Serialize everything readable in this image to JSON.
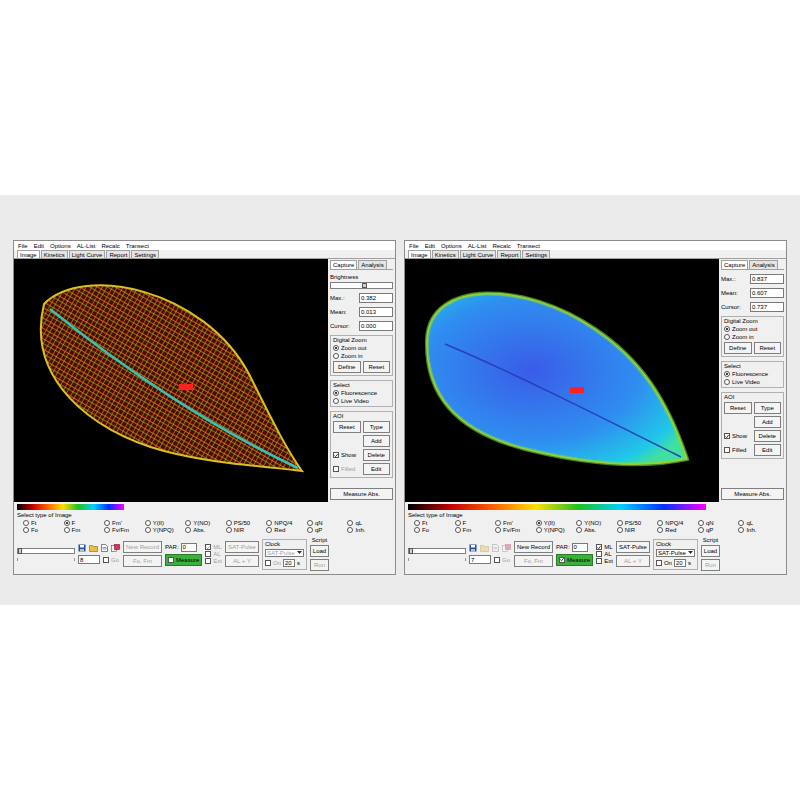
{
  "windows": [
    {
      "menu": [
        "File",
        "Edit",
        "Options",
        "AL-List",
        "Recalc",
        "Transect"
      ],
      "tabs": [
        {
          "label": "Image",
          "selected": true
        },
        {
          "label": "Kinetics",
          "selected": false
        },
        {
          "label": "Light Curve",
          "selected": false
        },
        {
          "label": "Report",
          "selected": false
        },
        {
          "label": "Settings",
          "selected": false
        }
      ],
      "image": {
        "kind": "veins"
      },
      "side_tabs": [
        {
          "label": "Capture",
          "selected": true
        },
        {
          "label": "Analysis",
          "selected": false
        }
      ],
      "brightness": {
        "label": "Brightness",
        "level": 0.55
      },
      "readings": [
        {
          "label": "Max.:",
          "value": "0.382"
        },
        {
          "label": "Mean:",
          "value": "0.013"
        },
        {
          "label": "Cursor:",
          "value": "0.000"
        }
      ],
      "digital_zoom": {
        "title": "Digital Zoom",
        "options": [
          {
            "label": "Zoom out",
            "selected": true
          },
          {
            "label": "Zoom in",
            "selected": false
          }
        ],
        "buttons": [
          {
            "label": "Define",
            "disabled": false
          },
          {
            "label": "Reset",
            "disabled": false
          }
        ]
      },
      "select": {
        "title": "Select",
        "options": [
          {
            "label": "Fluorescence",
            "selected": true
          },
          {
            "label": "Live Video",
            "selected": false
          }
        ]
      },
      "aoi": {
        "title": "AOI",
        "items": [
          {
            "kind": "button",
            "label": "Reset",
            "disabled": false
          },
          {
            "kind": "button",
            "label": "Type",
            "disabled": false
          },
          {
            "kind": "button",
            "label": "Add",
            "disabled": false
          },
          {
            "kind": "check",
            "label": "Show",
            "checked": true,
            "disabled": false
          },
          {
            "kind": "button",
            "label": "Delete",
            "disabled": false
          },
          {
            "kind": "check",
            "label": "Filled",
            "checked": false,
            "disabled": true
          },
          {
            "kind": "button",
            "label": "Edit",
            "disabled": false
          }
        ]
      },
      "measure_abs": {
        "label": "Measure Abs.",
        "disabled": false
      },
      "colorbar": {
        "level": 0.34
      },
      "image_types": {
        "title": "Select type of Image",
        "options": [
          {
            "label": "Ft",
            "selected": false
          },
          {
            "label": "F",
            "selected": true
          },
          {
            "label": "Fm'",
            "selected": false
          },
          {
            "label": "Y(II)",
            "selected": false
          },
          {
            "label": "Y(NO)",
            "selected": false
          },
          {
            "label": "PS/50",
            "selected": false
          },
          {
            "label": "NPQ/4",
            "selected": false
          },
          {
            "label": "qN",
            "selected": false
          },
          {
            "label": "qL",
            "selected": false
          },
          {
            "label": "Fo",
            "selected": false
          },
          {
            "label": "Fm",
            "selected": false
          },
          {
            "label": "Fv/Fm",
            "selected": false
          },
          {
            "label": "Y(NPQ)",
            "selected": false
          },
          {
            "label": "Abs.",
            "selected": false
          },
          {
            "label": "NIR",
            "selected": false
          },
          {
            "label": "Red",
            "selected": false
          },
          {
            "label": "qP",
            "selected": false
          },
          {
            "label": "Inh.",
            "selected": false
          }
        ]
      },
      "controls": {
        "slider": {
          "level": 0
        },
        "icons": [
          {
            "disabled": false
          },
          {
            "disabled": false
          },
          {
            "disabled": false
          },
          {
            "disabled": false
          }
        ],
        "record": "8",
        "go": {
          "label": "Go",
          "checked": false,
          "disabled": true
        },
        "new_record": {
          "label": "New Record",
          "disabled": true
        },
        "fo_fm": {
          "label": "Fo, Fm",
          "disabled": true
        },
        "par": {
          "label": "PAR:",
          "value": "0"
        },
        "measure": {
          "label": "Measure",
          "checked": false,
          "disabled": true
        },
        "lights": [
          {
            "label": "ML",
            "checked": true,
            "disabled": true
          },
          {
            "label": "AL",
            "checked": false,
            "disabled": true
          },
          {
            "label": "Ext",
            "checked": false,
            "disabled": true
          }
        ],
        "sat_pulse": {
          "label": "SAT-Pulse",
          "disabled": true
        },
        "al_y": {
          "label": "AL + Y",
          "disabled": true
        },
        "clock": {
          "title": "Clock",
          "mode": "SAT-Pulse",
          "disabled": true,
          "on": {
            "label": "On",
            "checked": false
          },
          "interval": "20",
          "unit": "s"
        },
        "script": {
          "title": "Script",
          "buttons": [
            {
              "label": "Load",
              "disabled": false
            },
            {
              "label": "Run",
              "disabled": true
            }
          ]
        }
      }
    },
    {
      "menu": [
        "File",
        "Edit",
        "Options",
        "AL-List",
        "Recalc",
        "Transect"
      ],
      "tabs": [
        {
          "label": "Image",
          "selected": true
        },
        {
          "label": "Kinetics",
          "selected": false
        },
        {
          "label": "Light Curve",
          "selected": false
        },
        {
          "label": "Report",
          "selected": false
        },
        {
          "label": "Settings",
          "selected": false
        }
      ],
      "image": {
        "kind": "yield"
      },
      "side_tabs": [
        {
          "label": "Capture",
          "selected": true
        },
        {
          "label": "Analysis",
          "selected": false
        }
      ],
      "readings": [
        {
          "label": "Max.:",
          "value": "0.837"
        },
        {
          "label": "Mean:",
          "value": "0.607"
        },
        {
          "label": "Cursor:",
          "value": "0.737"
        }
      ],
      "digital_zoom": {
        "title": "Digital Zoom",
        "options": [
          {
            "label": "Zoom out",
            "selected": true
          },
          {
            "label": "Zoom in",
            "selected": false
          }
        ],
        "buttons": [
          {
            "label": "Define",
            "disabled": false
          },
          {
            "label": "Reset",
            "disabled": false
          }
        ]
      },
      "select": {
        "title": "Select",
        "options": [
          {
            "label": "Fluorescence",
            "selected": true
          },
          {
            "label": "Live Video",
            "selected": false
          }
        ]
      },
      "aoi": {
        "title": "AOI",
        "items": [
          {
            "kind": "button",
            "label": "Reset",
            "disabled": false
          },
          {
            "kind": "button",
            "label": "Type",
            "disabled": false
          },
          {
            "kind": "button",
            "label": "Add",
            "disabled": false
          },
          {
            "kind": "check",
            "label": "Show",
            "checked": true,
            "disabled": false
          },
          {
            "kind": "button",
            "label": "Delete",
            "disabled": false
          },
          {
            "kind": "check",
            "label": "Filled",
            "checked": false,
            "disabled": false
          },
          {
            "kind": "button",
            "label": "Edit",
            "disabled": false
          }
        ]
      },
      "measure_abs": {
        "label": "Measure Abs.",
        "disabled": false
      },
      "colorbar": {
        "level": 0.95
      },
      "image_types": {
        "title": "Select type of Image",
        "options": [
          {
            "label": "Ft",
            "selected": false
          },
          {
            "label": "F",
            "selected": false
          },
          {
            "label": "Fm'",
            "selected": false
          },
          {
            "label": "Y(II)",
            "selected": true
          },
          {
            "label": "Y(NO)",
            "selected": false
          },
          {
            "label": "PS/50",
            "selected": false
          },
          {
            "label": "NPQ/4",
            "selected": false
          },
          {
            "label": "qN",
            "selected": false
          },
          {
            "label": "qL",
            "selected": false
          },
          {
            "label": "Fo",
            "selected": false
          },
          {
            "label": "Fm",
            "selected": false
          },
          {
            "label": "Fv/Fm",
            "selected": false
          },
          {
            "label": "Y(NPQ)",
            "selected": false
          },
          {
            "label": "Abs.",
            "selected": false
          },
          {
            "label": "NIR",
            "selected": false
          },
          {
            "label": "Red",
            "selected": false
          },
          {
            "label": "qP",
            "selected": false
          },
          {
            "label": "Inh.",
            "selected": false
          }
        ]
      },
      "controls": {
        "slider": {
          "level": 0
        },
        "icons": [
          {
            "disabled": false
          },
          {
            "disabled": true
          },
          {
            "disabled": true
          },
          {
            "disabled": true
          }
        ],
        "record": "7",
        "go": {
          "label": "Go",
          "checked": false,
          "disabled": true
        },
        "new_record": {
          "label": "New Record",
          "disabled": false
        },
        "fo_fm": {
          "label": "Fo, Fm",
          "disabled": true
        },
        "par": {
          "label": "PAR:",
          "value": "0"
        },
        "measure": {
          "label": "Measure",
          "checked": true,
          "disabled": false
        },
        "lights": [
          {
            "label": "ML",
            "checked": true,
            "disabled": false
          },
          {
            "label": "AL",
            "checked": false,
            "disabled": false
          },
          {
            "label": "Ext",
            "checked": false,
            "disabled": false
          }
        ],
        "sat_pulse": {
          "label": "SAT-Pulse",
          "disabled": false
        },
        "al_y": {
          "label": "AL + Y",
          "disabled": true
        },
        "clock": {
          "title": "Clock",
          "mode": "SAT-Pulse",
          "disabled": false,
          "on": {
            "label": "On",
            "checked": false
          },
          "interval": "20",
          "unit": "s"
        },
        "script": {
          "title": "Script",
          "buttons": [
            {
              "label": "Load",
              "disabled": false
            },
            {
              "label": "Run",
              "disabled": true
            }
          ]
        }
      }
    }
  ]
}
